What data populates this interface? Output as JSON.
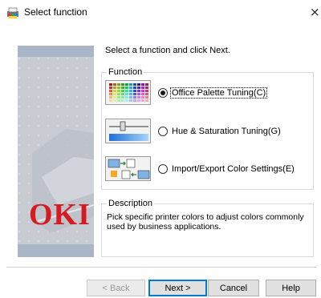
{
  "window": {
    "title": "Select function",
    "close_glyph": "×",
    "icon": "printer-app-icon"
  },
  "sidebar": {
    "logo_text": "OKI",
    "logo_color": "#d71920"
  },
  "main": {
    "instruction": "Select a function and click Next.",
    "function_group": {
      "label": "Function",
      "options": [
        {
          "label": "Office Palette Tuning(C)",
          "selected": true,
          "icon": "color-palette-icon"
        },
        {
          "label": "Hue & Saturation Tuning(G)",
          "selected": false,
          "icon": "hue-slider-icon"
        },
        {
          "label": "Import/Export Color Settings(E)",
          "selected": false,
          "icon": "import-export-icon"
        }
      ]
    },
    "description_group": {
      "label": "Description",
      "text": "Pick specific printer colors to adjust colors commonly used by business applications."
    }
  },
  "buttons": {
    "back": "< Back",
    "next": "Next >",
    "cancel": "Cancel",
    "help": "Help"
  }
}
